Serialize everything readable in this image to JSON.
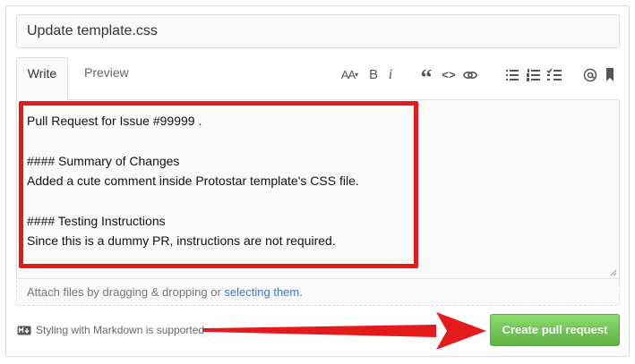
{
  "title_field": {
    "value": "Update template.css"
  },
  "tabs": [
    {
      "label": "Write",
      "active": true
    },
    {
      "label": "Preview",
      "active": false
    }
  ],
  "toolbar": {
    "heading_label": "AA",
    "bold_label": "B",
    "italic_label": "i",
    "quote_label": "“",
    "code_label": "<>"
  },
  "editor": {
    "lines": [
      "Pull Request for Issue #99999 .",
      "",
      "#### Summary of Changes",
      "Added a cute comment inside Protostar template's CSS file.",
      "",
      "#### Testing Instructions",
      "Since this is a dummy PR, instructions are not required."
    ]
  },
  "attach": {
    "prefix": "Attach files by dragging & dropping or ",
    "link": "selecting them",
    "suffix": "."
  },
  "markdown_note": "Styling with Markdown is supported",
  "submit": {
    "label": "Create pull request"
  },
  "colors": {
    "annotation_red": "#e51b1b",
    "button_green": "#6cc644",
    "link_blue": "#4078c0"
  }
}
